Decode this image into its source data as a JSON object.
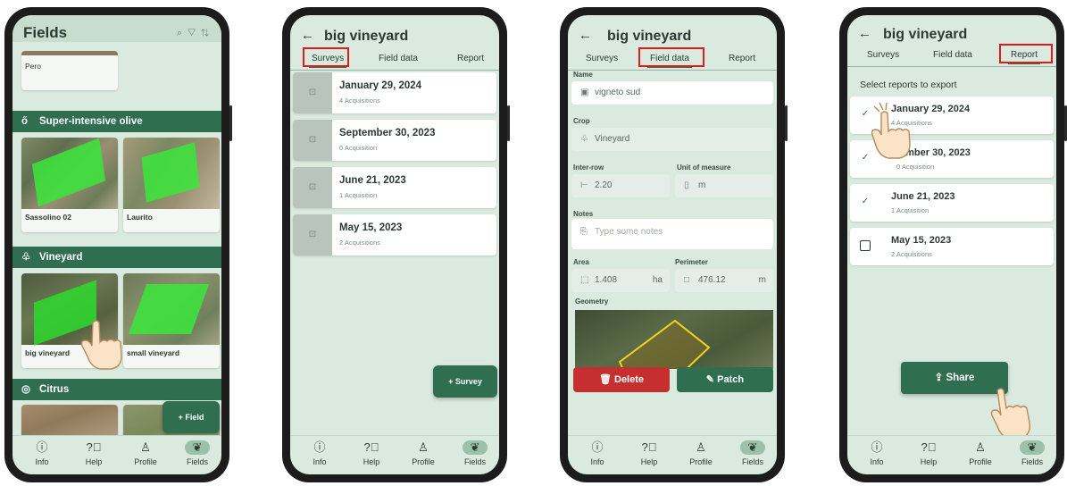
{
  "colors": {
    "accent": "#2f6e4e",
    "screen_bg": "#dbeadf",
    "delete": "#c62f2f",
    "highlight": "#e01b1b",
    "polygon": "#3ce43c"
  },
  "nav": [
    {
      "label": "Info",
      "icon": "info-icon"
    },
    {
      "label": "Help",
      "icon": "help-icon"
    },
    {
      "label": "Profile",
      "icon": "profile-icon"
    },
    {
      "label": "Fields",
      "icon": "fields-icon"
    }
  ],
  "screen1": {
    "title": "Fields",
    "top_card": "Pero",
    "sections": [
      {
        "name": "Super-intensive olive",
        "icon": "olive-icon",
        "cards": [
          "Sassolino 02",
          "Laurito"
        ]
      },
      {
        "name": "Vineyard",
        "icon": "grape-icon",
        "cards": [
          "big vineyard",
          "small vineyard"
        ]
      },
      {
        "name": "Citrus",
        "icon": "citrus-icon",
        "cards": []
      }
    ],
    "fab": "+ Field"
  },
  "field_title": "big vineyard",
  "tabs": [
    "Surveys",
    "Field data",
    "Report"
  ],
  "screen2": {
    "surveys": [
      {
        "date": "January 29, 2024",
        "acq": "4 Acquisitions"
      },
      {
        "date": "September 30, 2023",
        "acq": "0 Acquisition"
      },
      {
        "date": "June 21, 2023",
        "acq": "1 Acquisition"
      },
      {
        "date": "May 15, 2023",
        "acq": "2 Acquisitions"
      }
    ],
    "fab": "+ Survey"
  },
  "screen3": {
    "name_label": "Name",
    "name_value": "vigneto sud",
    "crop_label": "Crop",
    "crop_value": "Vineyard",
    "interrow_label": "Inter-row",
    "interrow_value": "2.20",
    "uom_label": "Unit of measure",
    "uom_value": "m",
    "notes_label": "Notes",
    "notes_placeholder": "Type some notes",
    "area_label": "Area",
    "area_value": "1.408",
    "area_unit": "ha",
    "perimeter_label": "Perimeter",
    "perimeter_value": "476.12",
    "perimeter_unit": "m",
    "geometry_label": "Geometry",
    "delete": "Delete",
    "patch": "Patch"
  },
  "screen4": {
    "heading": "Select reports to export",
    "reports": [
      {
        "date": "January 29, 2024",
        "acq": "4 Acquisitions",
        "checked": true
      },
      {
        "date": "ember 30, 2023",
        "acq": "0 Acquisition",
        "checked": true
      },
      {
        "date": "June 21, 2023",
        "acq": "1 Acquisition",
        "checked": true
      },
      {
        "date": "May 15, 2023",
        "acq": "2 Acquisitions",
        "checked": false
      }
    ],
    "share": "Share"
  }
}
